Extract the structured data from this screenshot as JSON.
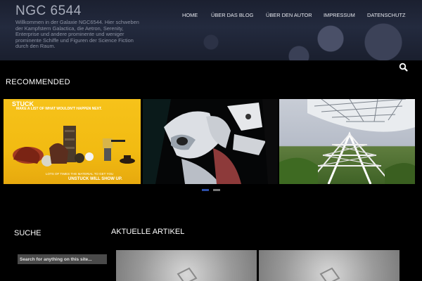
{
  "site": {
    "title": "NGC 6544",
    "description": "Willkommen in der Galaxie NGC6544. Hier schweben der Kampfstern Galactica, die Aetron, Serenity, Enterprise und andere prominente und weniger prominente Schiffe und Figuren der Science Fiction durch den Raum."
  },
  "nav": {
    "items": [
      "HOME",
      "ÜBER DAS BLOG",
      "ÜBER DEN AUTOR",
      "IMPRESSUM",
      "DATENSCHUTZ"
    ]
  },
  "header": {
    "search_icon": "search-icon"
  },
  "recommended": {
    "heading": "RECOMMENDED",
    "slides": [
      {
        "title": "STUCK",
        "line": "MAKE A LIST OF WHAT WOULDN'T HAPPEN NEXT.",
        "bottom": "LOTS OF TIMES THE MATERIAL TO GET YOU",
        "word": "UNSTUCK WILL SHOW UP."
      },
      {
        "image": "anime-robot-illustration"
      },
      {
        "image": "radio-telescope-dish"
      }
    ],
    "active_slide": 1,
    "slide_count": 2
  },
  "sidebar": {
    "heading": "SUCHE",
    "search_placeholder": "Search for anything on this site..."
  },
  "articles": {
    "heading": "AKTUELLE ARTIKEL"
  },
  "colors": {
    "active_dot": "#2d4fa8",
    "inactive_dot": "#777777",
    "slide1_bg": "#f6c21a"
  }
}
